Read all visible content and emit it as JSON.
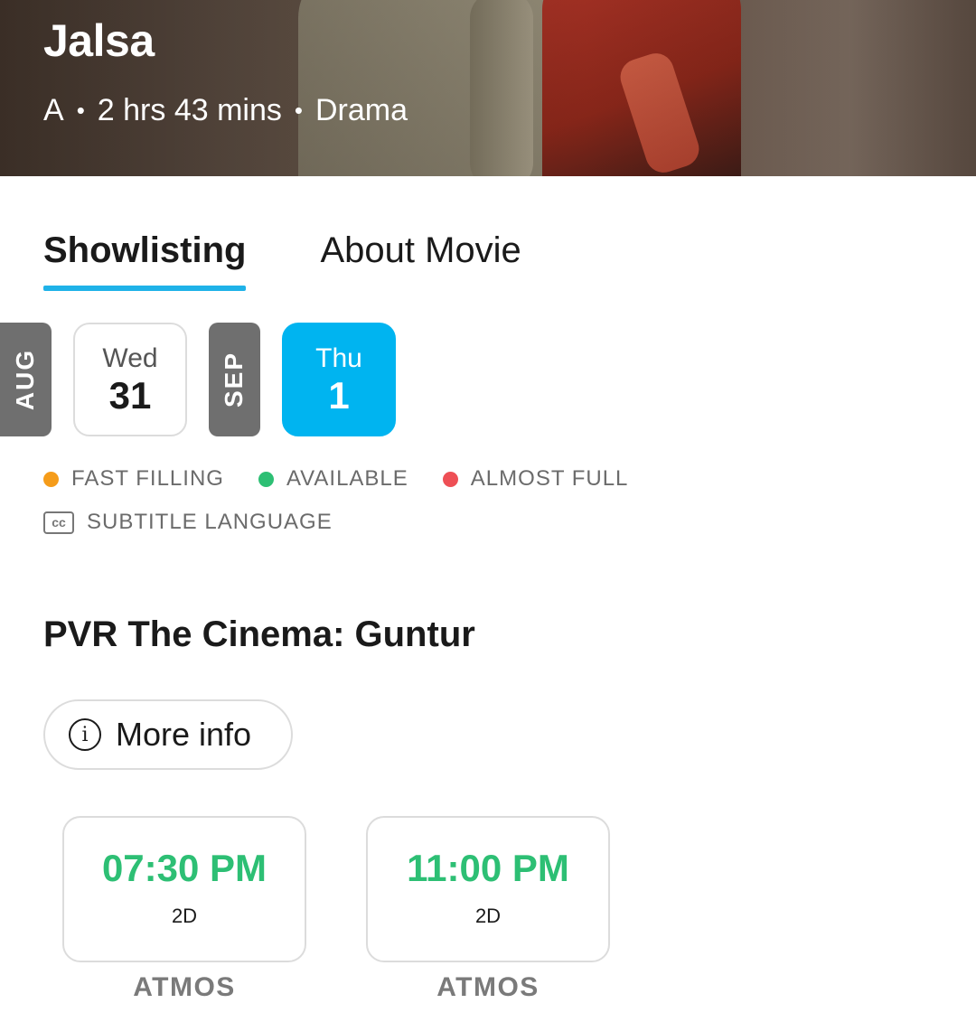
{
  "movie": {
    "title": "Jalsa",
    "certificate": "A",
    "duration": "2 hrs 43 mins",
    "genre": "Drama",
    "separator": "•"
  },
  "tabs": [
    {
      "label": "Showlisting",
      "active": true
    },
    {
      "label": "About Movie",
      "active": false
    }
  ],
  "dates": {
    "months": [
      "AUG",
      "SEP"
    ],
    "days": [
      {
        "dow": "Wed",
        "day": "31",
        "selected": false
      },
      {
        "dow": "Thu",
        "day": "1",
        "selected": true
      }
    ]
  },
  "legend": {
    "items": [
      {
        "label": "FAST FILLING",
        "color": "#f59c1a"
      },
      {
        "label": "AVAILABLE",
        "color": "#2dbf74"
      },
      {
        "label": "ALMOST FULL",
        "color": "#ee4f55"
      }
    ],
    "subtitle_icon_text": "cc",
    "subtitle_label": "SUBTITLE LANGUAGE"
  },
  "cinema": {
    "name": "PVR The Cinema: Guntur",
    "more_info_label": "More info",
    "info_icon_glyph": "i"
  },
  "showtimes": [
    {
      "time": "07:30 PM",
      "format": "2D",
      "sound": "ATMOS"
    },
    {
      "time": "11:00 PM",
      "format": "2D",
      "sound": "ATMOS"
    }
  ],
  "colors": {
    "accent": "#1fb2e8",
    "selected_date": "#00b4f0",
    "available": "#2dbf74"
  }
}
